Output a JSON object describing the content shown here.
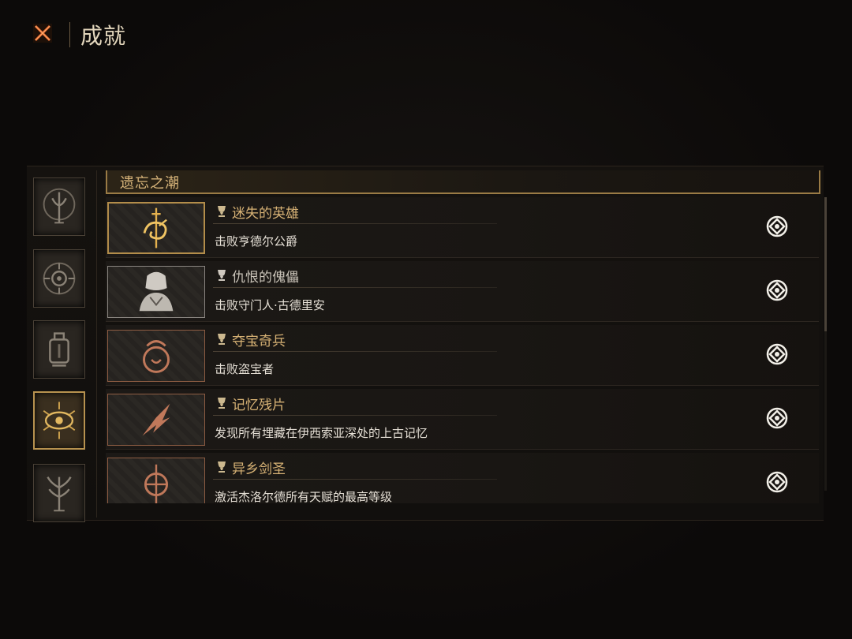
{
  "header": {
    "title": "成就",
    "close_icon": "close-x-icon"
  },
  "categories": [
    {
      "icon": "tide-trident-icon",
      "active": false
    },
    {
      "icon": "eye-sigil-icon",
      "active": false
    },
    {
      "icon": "lantern-icon",
      "active": false
    },
    {
      "icon": "radiant-eye-icon",
      "active": true
    },
    {
      "icon": "thorn-tree-icon",
      "active": false
    }
  ],
  "section": {
    "title": "遗忘之潮"
  },
  "achievements": [
    {
      "title": "迷失的英雄",
      "description": "击败亨德尔公爵",
      "tier": "gold",
      "icon": "hero-sword-emblem-icon"
    },
    {
      "title": "仇恨的傀儡",
      "description": "击败守门人·古德里安",
      "tier": "silver",
      "icon": "golem-bust-icon"
    },
    {
      "title": "夺宝奇兵",
      "description": "击败盗宝者",
      "tier": "copper",
      "icon": "treasure-thief-icon"
    },
    {
      "title": "记忆残片",
      "description": "发现所有埋藏在伊西索亚深处的上古记忆",
      "tier": "copper",
      "icon": "memory-shard-icon"
    },
    {
      "title": "异乡剑圣",
      "description": "激活杰洛尔德所有天赋的最高等级",
      "tier": "copper",
      "icon": "sword-saint-icon"
    }
  ],
  "colors": {
    "gold": "#d7b275",
    "accent_border": "#9a7b45",
    "close": "#e0622b"
  }
}
